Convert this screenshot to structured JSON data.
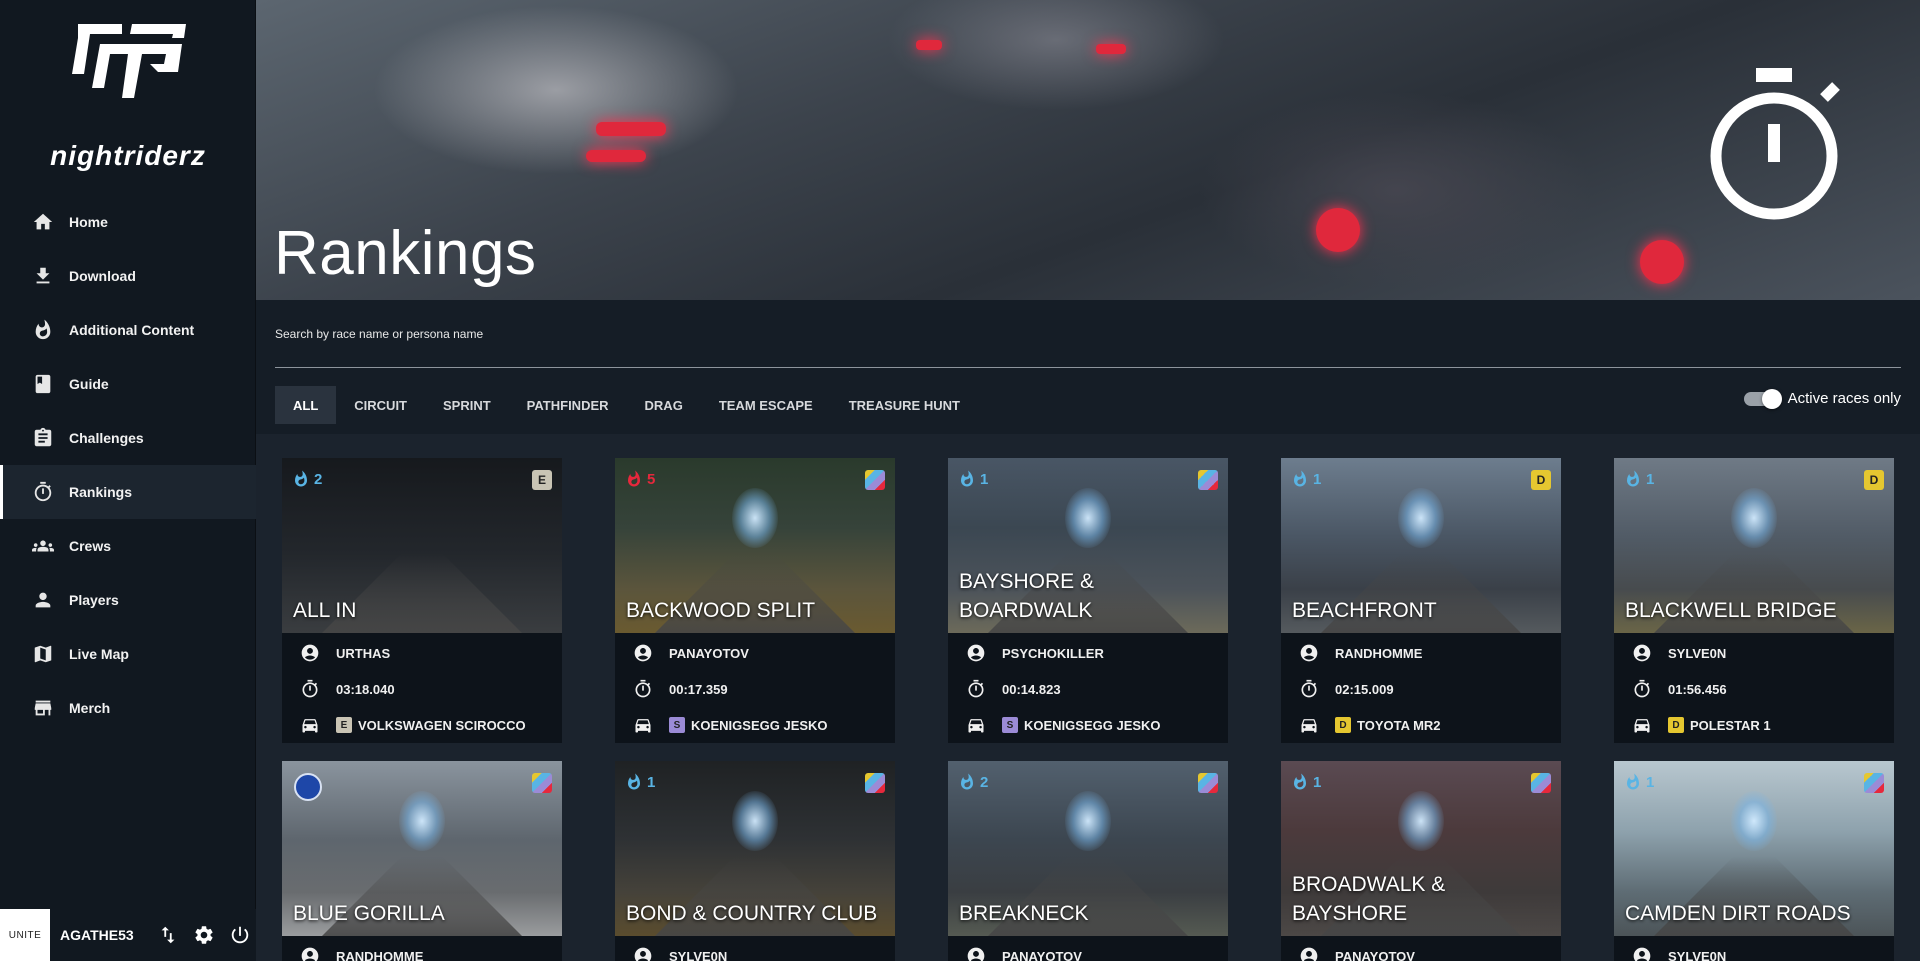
{
  "sidebar": {
    "logo_text": "nightriderz",
    "items": [
      {
        "label": "Home",
        "icon": "home-icon"
      },
      {
        "label": "Download",
        "icon": "download-icon"
      },
      {
        "label": "Additional Content",
        "icon": "flame-icon"
      },
      {
        "label": "Guide",
        "icon": "book-icon"
      },
      {
        "label": "Challenges",
        "icon": "clipboard-icon"
      },
      {
        "label": "Rankings",
        "icon": "stopwatch-icon",
        "active": true
      },
      {
        "label": "Crews",
        "icon": "group-icon"
      },
      {
        "label": "Players",
        "icon": "person-icon"
      },
      {
        "label": "Live Map",
        "icon": "map-icon"
      },
      {
        "label": "Merch",
        "icon": "store-icon"
      }
    ],
    "bottom": {
      "badge": "UNITE",
      "username": "AGATHE53"
    }
  },
  "header": {
    "title": "Rankings"
  },
  "search": {
    "placeholder": "Search by race name or persona name",
    "value": ""
  },
  "filters": {
    "tabs": [
      "ALL",
      "CIRCUIT",
      "SPRINT",
      "PATHFINDER",
      "DRAG",
      "TEAM ESCAPE",
      "TREASURE HUNT"
    ],
    "active": "ALL",
    "toggle_label": "Active races only",
    "toggle_on": true
  },
  "cards": [
    {
      "title": "ALL IN",
      "heat": "2",
      "heat_color": "#59b4e4",
      "class": "E",
      "class_color": "#c9c4b4",
      "player": "URTHAS",
      "time": "03:18.040",
      "car": "VOLKSWAGEN SCIROCCO",
      "car_class": "E",
      "car_class_color": "#c9c4b4"
    },
    {
      "title": "BACKWOOD SPLIT",
      "heat": "5",
      "heat_color": "#e6283c",
      "class": "",
      "class_color": "multi",
      "player": "PANAYOTOV",
      "time": "00:17.359",
      "car": "KOENIGSEGG JESKO",
      "car_class": "S",
      "car_class_color": "#9b8bd6"
    },
    {
      "title": "BAYSHORE & BOARDWALK",
      "heat": "1",
      "heat_color": "#59b4e4",
      "class": "",
      "class_color": "multi",
      "player": "PSYCHOKILLER",
      "time": "00:14.823",
      "car": "KOENIGSEGG JESKO",
      "car_class": "S",
      "car_class_color": "#9b8bd6"
    },
    {
      "title": "BEACHFRONT",
      "heat": "1",
      "heat_color": "#59b4e4",
      "class": "D",
      "class_color": "#e5c730",
      "player": "RANDHOMME",
      "time": "02:15.009",
      "car": "TOYOTA MR2",
      "car_class": "D",
      "car_class_color": "#e5c730"
    },
    {
      "title": "BLACKWELL BRIDGE",
      "heat": "1",
      "heat_color": "#59b4e4",
      "class": "D",
      "class_color": "#e5c730",
      "player": "SYLVE0N",
      "time": "01:56.456",
      "car": "POLESTAR 1",
      "car_class": "D",
      "car_class_color": "#e5c730"
    },
    {
      "title": "BLUE GORILLA",
      "heat": "",
      "heat_color": "#59b4e4",
      "class": "",
      "class_color": "multi",
      "player": "RANDHOMME",
      "pro": true
    },
    {
      "title": "BOND & COUNTRY CLUB",
      "heat": "1",
      "heat_color": "#59b4e4",
      "class": "",
      "class_color": "multi",
      "player": "SYLVE0N"
    },
    {
      "title": "BREAKNECK",
      "heat": "2",
      "heat_color": "#59b4e4",
      "class": "",
      "class_color": "multi",
      "player": "PANAYOTOV"
    },
    {
      "title": "BROADWALK & BAYSHORE",
      "heat": "1",
      "heat_color": "#59b4e4",
      "class": "",
      "class_color": "multi",
      "player": "PANAYOTOV"
    },
    {
      "title": "CAMDEN DIRT ROADS",
      "heat": "1",
      "heat_color": "#59b4e4",
      "class": "",
      "class_color": "multi",
      "player": "SYLVE0N"
    }
  ]
}
